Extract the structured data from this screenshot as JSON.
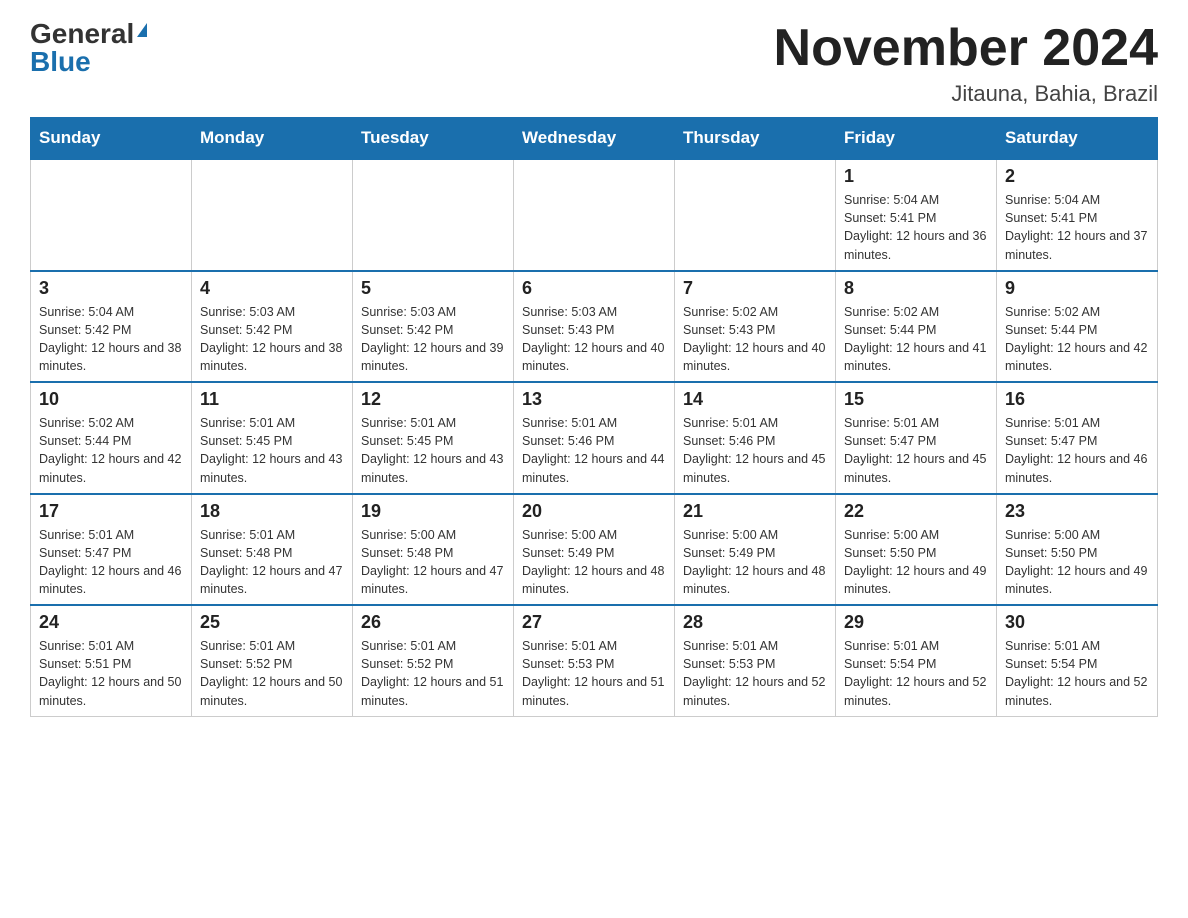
{
  "logo": {
    "general": "General",
    "blue": "Blue"
  },
  "header": {
    "title": "November 2024",
    "subtitle": "Jitauna, Bahia, Brazil"
  },
  "days_of_week": [
    "Sunday",
    "Monday",
    "Tuesday",
    "Wednesday",
    "Thursday",
    "Friday",
    "Saturday"
  ],
  "weeks": [
    [
      {
        "day": "",
        "info": ""
      },
      {
        "day": "",
        "info": ""
      },
      {
        "day": "",
        "info": ""
      },
      {
        "day": "",
        "info": ""
      },
      {
        "day": "",
        "info": ""
      },
      {
        "day": "1",
        "info": "Sunrise: 5:04 AM\nSunset: 5:41 PM\nDaylight: 12 hours and 36 minutes."
      },
      {
        "day": "2",
        "info": "Sunrise: 5:04 AM\nSunset: 5:41 PM\nDaylight: 12 hours and 37 minutes."
      }
    ],
    [
      {
        "day": "3",
        "info": "Sunrise: 5:04 AM\nSunset: 5:42 PM\nDaylight: 12 hours and 38 minutes."
      },
      {
        "day": "4",
        "info": "Sunrise: 5:03 AM\nSunset: 5:42 PM\nDaylight: 12 hours and 38 minutes."
      },
      {
        "day": "5",
        "info": "Sunrise: 5:03 AM\nSunset: 5:42 PM\nDaylight: 12 hours and 39 minutes."
      },
      {
        "day": "6",
        "info": "Sunrise: 5:03 AM\nSunset: 5:43 PM\nDaylight: 12 hours and 40 minutes."
      },
      {
        "day": "7",
        "info": "Sunrise: 5:02 AM\nSunset: 5:43 PM\nDaylight: 12 hours and 40 minutes."
      },
      {
        "day": "8",
        "info": "Sunrise: 5:02 AM\nSunset: 5:44 PM\nDaylight: 12 hours and 41 minutes."
      },
      {
        "day": "9",
        "info": "Sunrise: 5:02 AM\nSunset: 5:44 PM\nDaylight: 12 hours and 42 minutes."
      }
    ],
    [
      {
        "day": "10",
        "info": "Sunrise: 5:02 AM\nSunset: 5:44 PM\nDaylight: 12 hours and 42 minutes."
      },
      {
        "day": "11",
        "info": "Sunrise: 5:01 AM\nSunset: 5:45 PM\nDaylight: 12 hours and 43 minutes."
      },
      {
        "day": "12",
        "info": "Sunrise: 5:01 AM\nSunset: 5:45 PM\nDaylight: 12 hours and 43 minutes."
      },
      {
        "day": "13",
        "info": "Sunrise: 5:01 AM\nSunset: 5:46 PM\nDaylight: 12 hours and 44 minutes."
      },
      {
        "day": "14",
        "info": "Sunrise: 5:01 AM\nSunset: 5:46 PM\nDaylight: 12 hours and 45 minutes."
      },
      {
        "day": "15",
        "info": "Sunrise: 5:01 AM\nSunset: 5:47 PM\nDaylight: 12 hours and 45 minutes."
      },
      {
        "day": "16",
        "info": "Sunrise: 5:01 AM\nSunset: 5:47 PM\nDaylight: 12 hours and 46 minutes."
      }
    ],
    [
      {
        "day": "17",
        "info": "Sunrise: 5:01 AM\nSunset: 5:47 PM\nDaylight: 12 hours and 46 minutes."
      },
      {
        "day": "18",
        "info": "Sunrise: 5:01 AM\nSunset: 5:48 PM\nDaylight: 12 hours and 47 minutes."
      },
      {
        "day": "19",
        "info": "Sunrise: 5:00 AM\nSunset: 5:48 PM\nDaylight: 12 hours and 47 minutes."
      },
      {
        "day": "20",
        "info": "Sunrise: 5:00 AM\nSunset: 5:49 PM\nDaylight: 12 hours and 48 minutes."
      },
      {
        "day": "21",
        "info": "Sunrise: 5:00 AM\nSunset: 5:49 PM\nDaylight: 12 hours and 48 minutes."
      },
      {
        "day": "22",
        "info": "Sunrise: 5:00 AM\nSunset: 5:50 PM\nDaylight: 12 hours and 49 minutes."
      },
      {
        "day": "23",
        "info": "Sunrise: 5:00 AM\nSunset: 5:50 PM\nDaylight: 12 hours and 49 minutes."
      }
    ],
    [
      {
        "day": "24",
        "info": "Sunrise: 5:01 AM\nSunset: 5:51 PM\nDaylight: 12 hours and 50 minutes."
      },
      {
        "day": "25",
        "info": "Sunrise: 5:01 AM\nSunset: 5:52 PM\nDaylight: 12 hours and 50 minutes."
      },
      {
        "day": "26",
        "info": "Sunrise: 5:01 AM\nSunset: 5:52 PM\nDaylight: 12 hours and 51 minutes."
      },
      {
        "day": "27",
        "info": "Sunrise: 5:01 AM\nSunset: 5:53 PM\nDaylight: 12 hours and 51 minutes."
      },
      {
        "day": "28",
        "info": "Sunrise: 5:01 AM\nSunset: 5:53 PM\nDaylight: 12 hours and 52 minutes."
      },
      {
        "day": "29",
        "info": "Sunrise: 5:01 AM\nSunset: 5:54 PM\nDaylight: 12 hours and 52 minutes."
      },
      {
        "day": "30",
        "info": "Sunrise: 5:01 AM\nSunset: 5:54 PM\nDaylight: 12 hours and 52 minutes."
      }
    ]
  ]
}
